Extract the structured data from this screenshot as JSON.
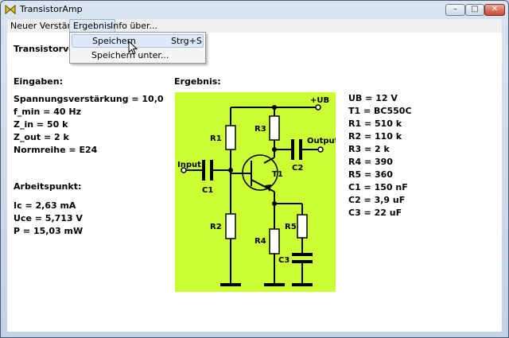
{
  "window": {
    "title": "TransistorAmp"
  },
  "menu": {
    "items": [
      "Neuer Verstärker",
      "Ergebnis",
      "Info über..."
    ],
    "dropdown": [
      {
        "label": "Speichern",
        "shortcut": "Strg+S"
      },
      {
        "label": "Speichern unter...",
        "shortcut": ""
      }
    ]
  },
  "content": {
    "heading": "Transistorverstärker",
    "inputs_heading": "Eingaben:",
    "inputs": [
      "Spannungsverstärkung = 10,0",
      "f_min = 40 Hz",
      "Z_in = 50 k",
      "Z_out = 2 k",
      "Normreihe = E24"
    ],
    "operating_heading": "Arbeitspunkt:",
    "operating": [
      "Ic = 2,63 mA",
      "Uce = 5,713 V",
      "P = 15,03 mW"
    ],
    "result_heading": "Ergebnis:",
    "results": [
      "UB = 12 V",
      "T1 = BC550C",
      "R1 = 510 k",
      "R2 = 110 k",
      "R3 = 2 k",
      "R4 = 390",
      "R5 = 360",
      "C1 = 150 nF",
      "C2 = 3,9 uF",
      "C3 = 22 uF"
    ]
  },
  "schematic": {
    "labels": {
      "ub": "+UB",
      "input": "Input",
      "output": "Output",
      "r1": "R1",
      "r2": "R2",
      "r3": "R3",
      "r4": "R4",
      "r5": "R5",
      "c1": "C1",
      "c2": "C2",
      "c3": "C3",
      "t1": "T1"
    }
  },
  "colors": {
    "schematic_bg": "#ccff33",
    "menu_hover": "#dde9f8"
  }
}
